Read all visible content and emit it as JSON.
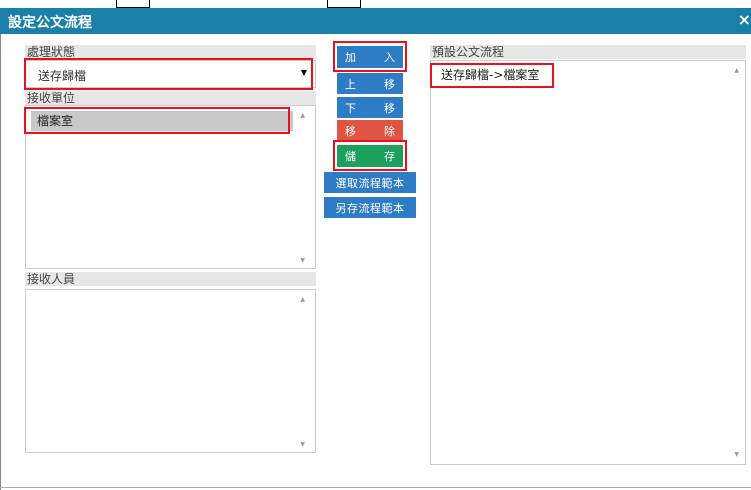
{
  "window": {
    "title": "設定公文流程",
    "close_glyph": "×"
  },
  "process_status": {
    "label": "處理狀態",
    "selected": "送存歸檔"
  },
  "receive_unit": {
    "label": "接收單位",
    "items": [
      "檔案室"
    ]
  },
  "receive_person": {
    "label": "接收人員"
  },
  "actions": {
    "add": [
      "加",
      "入"
    ],
    "move_up": [
      "上",
      "移"
    ],
    "move_down": [
      "下",
      "移"
    ],
    "remove": [
      "移",
      "除"
    ],
    "save": [
      "儲",
      "存"
    ],
    "pick_template": "選取流程範本",
    "save_template": "另存流程範本"
  },
  "default_flow": {
    "label": "預設公文流程",
    "items": [
      "送存歸檔->檔案室"
    ]
  },
  "colors": {
    "titlebar": "#1a7fa9",
    "button_blue": "#2f7cc6",
    "button_red": "#e05444",
    "button_green": "#1d9f5e",
    "highlight_border": "#e8121b"
  }
}
